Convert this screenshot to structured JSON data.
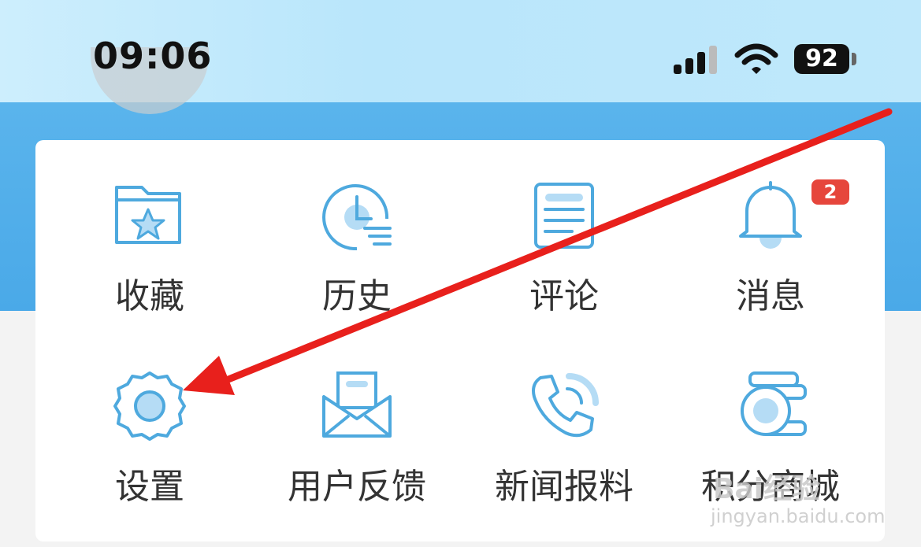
{
  "status_bar": {
    "time": "09:06",
    "battery": "92"
  },
  "menu": {
    "row1": [
      {
        "label": "收藏",
        "icon": "favorites-folder-star-icon"
      },
      {
        "label": "历史",
        "icon": "history-clock-icon"
      },
      {
        "label": "评论",
        "icon": "comment-document-icon"
      },
      {
        "label": "消息",
        "icon": "bell-icon",
        "badge": "2"
      }
    ],
    "row2": [
      {
        "label": "设置",
        "icon": "settings-gear-icon"
      },
      {
        "label": "用户反馈",
        "icon": "feedback-envelope-icon"
      },
      {
        "label": "新闻报料",
        "icon": "news-tip-phone-icon"
      },
      {
        "label": "积分商城",
        "icon": "points-mall-coins-icon"
      }
    ]
  },
  "annotation": {
    "arrow_color": "#e8201c",
    "target": "设置"
  },
  "watermark": {
    "text": "Bai经验",
    "sub": "jingyan.baidu.com"
  },
  "colors": {
    "icon_stroke": "#4ea9de",
    "icon_fill": "#b5dcf5",
    "header_blue": "#4aa9e8",
    "badge_red": "#e6463c"
  }
}
